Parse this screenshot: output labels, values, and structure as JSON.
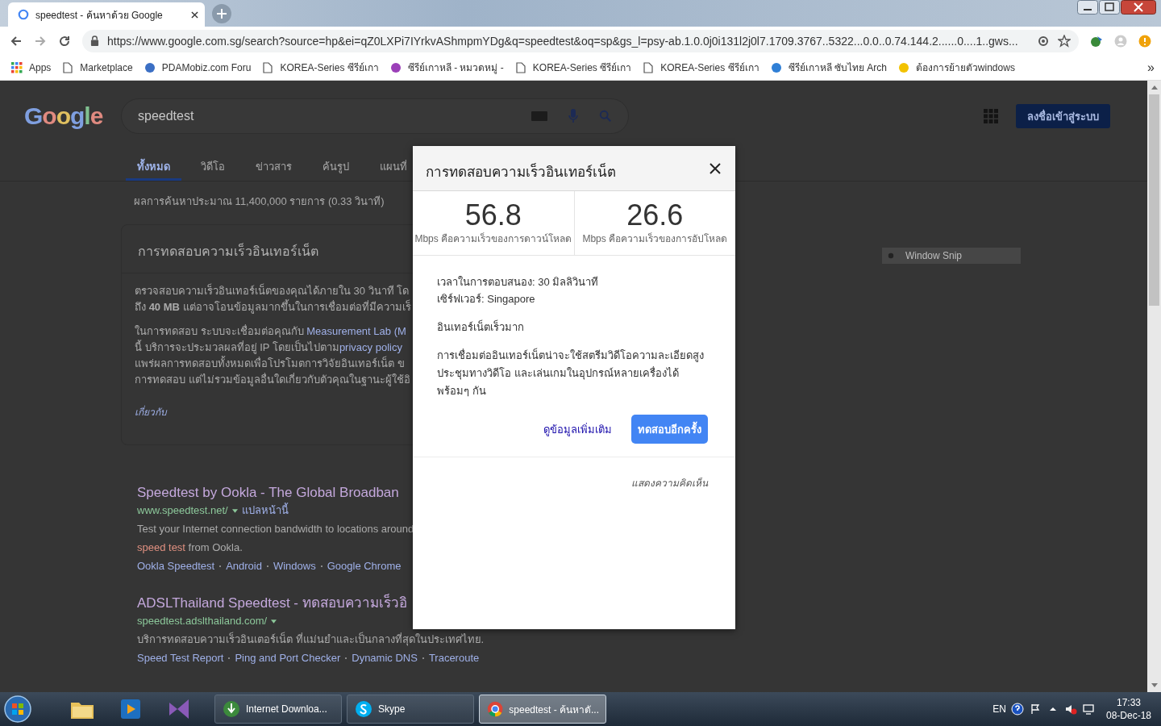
{
  "browser": {
    "tab": {
      "title": "speedtest - ค้นหาด้วย Google"
    },
    "url": "https://www.google.com.sg/search?source=hp&ei=qZ0LXPi7IYrkvAShmpmYDg&q=speedtest&oq=sp&gs_l=psy-ab.1.0.0j0i131l2j0l7.1709.3767..5322...0.0..0.74.144.2......0....1..gws...",
    "bookmarks": [
      {
        "label": "Apps",
        "kind": "apps"
      },
      {
        "label": "Marketplace",
        "kind": "page"
      },
      {
        "label": "PDAMobiz.com Foru",
        "kind": "favicon",
        "color": "#3b6fc4"
      },
      {
        "label": "KOREA-Series ซีรีย์เกา",
        "kind": "page"
      },
      {
        "label": "ซีรีย์เกาหลี - หมวดหมู่ -",
        "kind": "favicon",
        "color": "#9b3fb8"
      },
      {
        "label": "KOREA-Series ซีรีย์เกา",
        "kind": "page"
      },
      {
        "label": "KOREA-Series ซีรีย์เกา",
        "kind": "page"
      },
      {
        "label": "ซีรีย์เกาหลี ซับไทย Arch",
        "kind": "favicon",
        "color": "#2f7fd6"
      },
      {
        "label": "ต้องการย้ายตัวwindows",
        "kind": "favicon",
        "color": "#f2c200"
      }
    ],
    "bookmarks_more": "»"
  },
  "page": {
    "logo": "Google",
    "search": {
      "value": "speedtest"
    },
    "sign_in": "ลงชื่อเข้าสู่ระบบ",
    "tabs": [
      {
        "label": "ทั้งหมด",
        "selected": true
      },
      {
        "label": "วิดีโอ",
        "selected": false
      },
      {
        "label": "ข่าวสาร",
        "selected": false
      },
      {
        "label": "ค้นรูป",
        "selected": false
      },
      {
        "label": "แผนที่",
        "selected": false
      }
    ],
    "result_stats": "ผลการค้นหาประมาณ 11,400,000 รายการ (0.33 วินาที)",
    "card": {
      "title": "การทดสอบความเร็วอินเทอร์เน็ต",
      "paragraphs": [
        [
          [
            {
              "text": "ตรวจสอบความเร็วอินเทอร์เน็ตของคุณได้ภายใน 30 วินาที โด"
            }
          ],
          [
            {
              "text": "ถึง **40 MB** แต่อาจโอนข้อมูลมากขึ้นในการเชื่อมต่อที่มีความเร็"
            }
          ]
        ],
        [
          [
            {
              "text": "ในการทดสอบ ระบบจะเชื่อมต่อคุณกับ "
            },
            {
              "text": "Measurement Lab (M",
              "link": true
            }
          ],
          [
            {
              "text": "นี้ บริการจะประมวลผลที่อยู่ IP โดยเป็นไปตาม"
            },
            {
              "text": "privacy policy",
              "link": true
            }
          ],
          [
            {
              "text": "แพร่ผลการทดสอบทั้งหมดเพื่อโปรโมตการวิจัยอินเทอร์เน็ต ข"
            }
          ],
          [
            {
              "text": "การทดสอบ แต่ไม่รวมข้อมูลอื่นใดเกี่ยวกับตัวคุณในฐานะผู้ใช้อิ"
            }
          ]
        ]
      ],
      "about": "เกี่ยวกับ"
    },
    "results": [
      {
        "title": "Speedtest by Ookla - The Global Broadban",
        "url": "www.speedtest.net/",
        "translate": "แปลหน้านี้",
        "snippet": [
          [
            {
              "text": "Test your Internet connection bandwidth to locations around"
            }
          ],
          [
            {
              "text": "speed test",
              "hit": true
            },
            {
              "text": " from Ookla."
            }
          ]
        ],
        "sitelinks": [
          "Ookla Speedtest",
          "Android",
          "Windows",
          "Google Chrome"
        ]
      },
      {
        "title": "ADSLThailand Speedtest - ทดสอบความเร็วอิ",
        "url": "speedtest.adslthailand.com/",
        "snippet": [
          [
            {
              "text": "บริการทดสอบความเร็วอินเตอร์เน็ต ที่แม่นยำและเป็นกลางที่สุดในประเทศไทย."
            }
          ]
        ],
        "sitelinks": [
          "Speed Test Report",
          "Ping and Port Checker",
          "Dynamic DNS",
          "Traceroute"
        ]
      }
    ]
  },
  "dialog": {
    "title": "การทดสอบความเร็วอินเทอร์เน็ต",
    "speeds": [
      {
        "value": "56.8",
        "caption": "Mbps คือความเร็วของการดาวน์โหลด"
      },
      {
        "value": "26.6",
        "caption": "Mbps คือความเร็วของการอัปโหลด"
      }
    ],
    "latency": "เวลาในการตอบสนอง: 30 มิลลิวินาที",
    "server": "เซิร์ฟเวอร์: Singapore",
    "verdict": "อินเทอร์เน็ตเร็วมาก",
    "description": "การเชื่อมต่ออินเทอร์เน็ตน่าจะใช้สตรีมวิดีโอความละเอียดสูง ประชุมทางวิดีโอ และเล่นเกมในอุปกรณ์หลายเครื่องได้พร้อมๆ กัน",
    "more": "ดูข้อมูลเพิ่มเติม",
    "retest": "ทดสอบอีกครั้ง",
    "feedback": "แสดงความคิดเห็น"
  },
  "snip": {
    "label": "Window Snip"
  },
  "taskbar": {
    "tasks": [
      {
        "label": "Internet Downloa...",
        "kind": "download",
        "selected": false
      },
      {
        "label": "Skype",
        "kind": "skype",
        "selected": false
      },
      {
        "label": "speedtest - ค้นหาดั...",
        "kind": "chrome",
        "selected": true
      }
    ],
    "language": "EN",
    "time": "17:33",
    "date": "08-Dec-18"
  }
}
